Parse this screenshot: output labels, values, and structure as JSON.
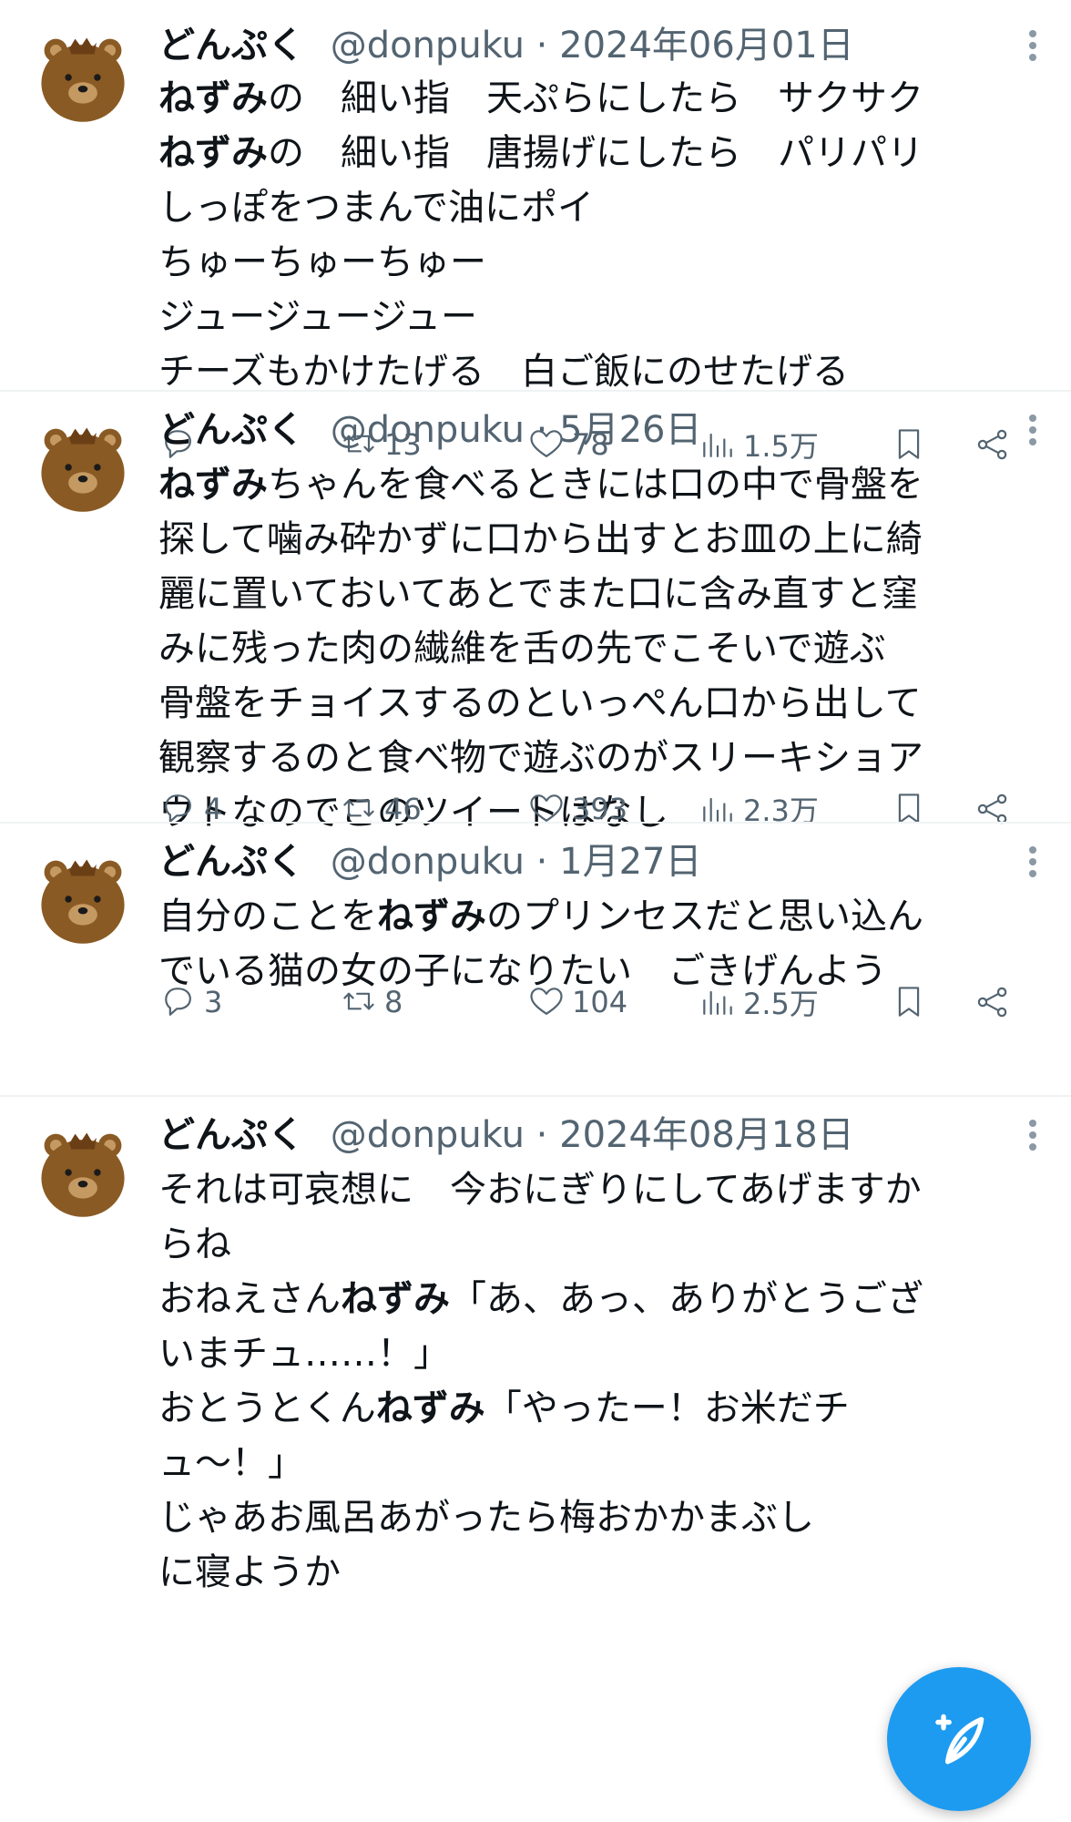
{
  "tweets": [
    {
      "name": "どんぷく",
      "handle": "@donpuku",
      "date": "2024年06月01日",
      "lines": [
        [
          {
            "t": "ねずみ",
            "b": true
          },
          {
            "t": "の　細い指　天ぷらにしたら　サクサク",
            "b": false
          }
        ],
        [
          {
            "t": "ねずみ",
            "b": true
          },
          {
            "t": "の　細い指　唐揚げにしたら　パリパリ",
            "b": false
          }
        ],
        [
          {
            "t": "しっぽをつまんで油にポイ",
            "b": false
          }
        ],
        [
          {
            "t": "ちゅーちゅーちゅー",
            "b": false
          }
        ],
        [
          {
            "t": "ジュージュージュー",
            "b": false
          }
        ],
        [
          {
            "t": "チーズもかけたげる　白ご飯にのせたげる",
            "b": false
          }
        ]
      ],
      "replies": "",
      "retweets": "13",
      "likes": "78",
      "views": "1.5万"
    },
    {
      "name": "どんぷく",
      "handle": "@donpuku",
      "date": "5月26日",
      "lines": [
        [
          {
            "t": "ねずみ",
            "b": true
          },
          {
            "t": "ちゃんを食べるときには口の中で骨盤を",
            "b": false
          }
        ],
        [
          {
            "t": "探して噛み砕かずに口から出すとお皿の上に綺",
            "b": false
          }
        ],
        [
          {
            "t": "麗に置いておいてあとでまた口に含み直すと窪",
            "b": false
          }
        ],
        [
          {
            "t": "みに残った肉の繊維を舌の先でこそいで遊ぶ",
            "b": false
          }
        ],
        [
          {
            "t": "骨盤をチョイスするのといっぺん口から出して",
            "b": false
          }
        ],
        [
          {
            "t": "観察するのと食べ物で遊ぶのがスリーキショア",
            "b": false
          }
        ],
        [
          {
            "t": "ウトなのでこのツイートはなし",
            "b": false
          }
        ]
      ],
      "replies": "4",
      "retweets": "46",
      "likes": "393",
      "views": "2.3万"
    },
    {
      "name": "どんぷく",
      "handle": "@donpuku",
      "date": "1月27日",
      "lines": [
        [
          {
            "t": "自分のことを",
            "b": false
          },
          {
            "t": "ねずみ",
            "b": true
          },
          {
            "t": "のプリンセスだと思い込ん",
            "b": false
          }
        ],
        [
          {
            "t": "でいる猫の女の子になりたい　ごきげんよう",
            "b": false
          }
        ]
      ],
      "replies": "3",
      "retweets": "8",
      "likes": "104",
      "views": "2.5万"
    },
    {
      "name": "どんぷく",
      "handle": "@donpuku",
      "date": "2024年08月18日",
      "lines": [
        [
          {
            "t": "それは可哀想に　今おにぎりにしてあげますか",
            "b": false
          }
        ],
        [
          {
            "t": "らね",
            "b": false
          }
        ],
        [
          {
            "t": "おねえさん",
            "b": false
          },
          {
            "t": "ねずみ",
            "b": true
          },
          {
            "t": "「あ、あっ、ありがとうござ",
            "b": false
          }
        ],
        [
          {
            "t": "いまチュ……！」",
            "b": false
          }
        ],
        [
          {
            "t": "おとうとくん",
            "b": false
          },
          {
            "t": "ねずみ",
            "b": true
          },
          {
            "t": "「やったー！お米だチ",
            "b": false
          }
        ],
        [
          {
            "t": "ュ〜！」",
            "b": false
          }
        ],
        [
          {
            "t": "じゃあお風呂あがったら梅おかかまぶし",
            "b": false
          }
        ],
        [
          {
            "t": "に寝ようか",
            "b": false
          }
        ]
      ],
      "replies": "",
      "retweets": "",
      "likes": "",
      "views": ""
    }
  ],
  "icons": {
    "avatar": "bear-avatar",
    "more": "more-vertical-icon",
    "reply": "reply-icon",
    "retweet": "retweet-icon",
    "like": "heart-icon",
    "views": "views-icon",
    "bookmark": "bookmark-icon",
    "share": "share-icon",
    "compose": "compose-post-icon"
  },
  "colors": {
    "text": "#0f1419",
    "secondary": "#536471",
    "divider": "#eff3f4",
    "accent": "#1d9bf0",
    "avatar_fur": "#8a5a24"
  }
}
